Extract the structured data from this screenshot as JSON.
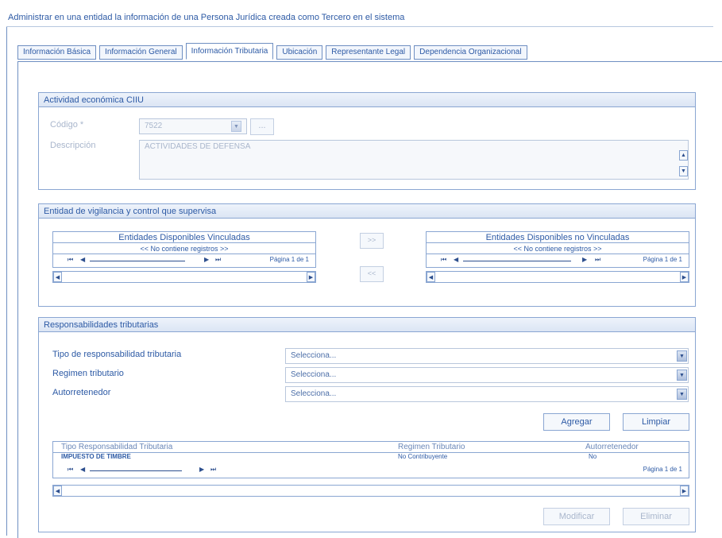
{
  "window": {
    "title": "Administrar en una entidad la información de una Persona Jurídica creada como Tercero en el sistema"
  },
  "tabs": [
    {
      "label": "Información Básica"
    },
    {
      "label": "Información General"
    },
    {
      "label": "Información Tributaria"
    },
    {
      "label": "Ubicación"
    },
    {
      "label": "Representante Legal"
    },
    {
      "label": "Dependencia Organizacional"
    }
  ],
  "actividad": {
    "header": "Actividad económica CIIU",
    "codigo_label": "Código *",
    "codigo_value": "7522",
    "lookup_button": "...",
    "descripcion_label": "Descripción",
    "descripcion_value": "ACTIVIDADES DE DEFENSA"
  },
  "vigilancia": {
    "header": "Entidad de vigilancia y control que supervisa",
    "linked": {
      "title": "Entidades Disponibles Vinculadas",
      "empty": "<< No contiene registros >>",
      "page_info": "Página 1 de 1"
    },
    "unlinked": {
      "title": "Entidades Disponibles no Vinculadas",
      "empty": "<< No contiene registros >>",
      "page_info": "Página 1 de 1"
    },
    "move_right": ">>",
    "move_left": "<<"
  },
  "responsabilidades": {
    "header": "Responsabilidades tributarias",
    "tipo_label": "Tipo de responsabilidad tributaria",
    "tipo_value": "Selecciona...",
    "regimen_label": "Regimen tributario",
    "regimen_value": "Selecciona...",
    "autorretenedor_label": "Autorretenedor",
    "autorretenedor_value": "Selecciona...",
    "add_button": "Agregar",
    "clear_button": "Limpiar",
    "table": {
      "headers": [
        "Tipo Responsabilidad Tributaria",
        "Regimen Tributario",
        "Autorretenedor"
      ],
      "rows": [
        {
          "tipo": "IMPUESTO DE TIMBRE",
          "regimen": "No Contribuyente",
          "autorretenedor": "No"
        }
      ],
      "page_info": "Página 1 de 1"
    },
    "modify_button": "Modificar",
    "delete_button": "Eliminar"
  },
  "icons": {
    "first": "⏮",
    "prev": "◀",
    "next": "▶",
    "last": "⏭",
    "left": "◀",
    "right": "▶",
    "up": "▲",
    "down": "▼"
  }
}
